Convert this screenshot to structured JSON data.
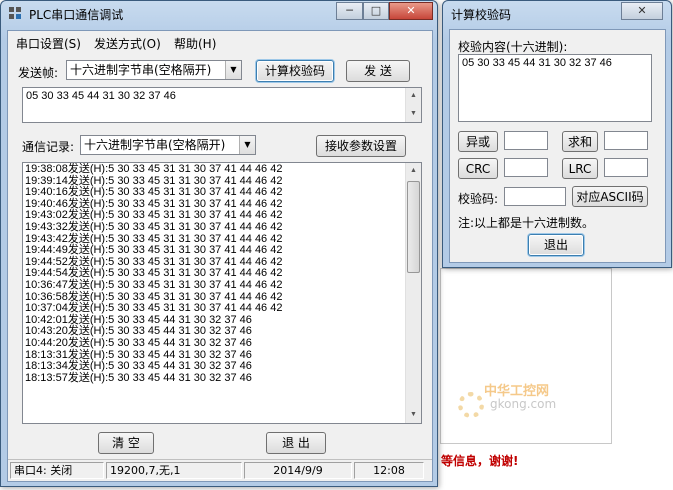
{
  "main_window": {
    "title": "PLC串口通信调试",
    "menu": [
      "串口设置(S)",
      "发送方式(O)",
      "帮助(H)"
    ],
    "send_frame_label": "发送帧:",
    "send_mode_value": "十六进制字节串(空格隔开)",
    "calc_checksum_button": "计算校验码",
    "send_button": "发 送",
    "send_input_value": "05 30 33  45 44 31 30 32 37 46",
    "comm_log_label": "通信记录:",
    "log_mode_value": "十六进制字节串(空格隔开)",
    "recv_settings_button": "接收参数设置",
    "log_lines": [
      "19:38:08发送(H):5 30 33 45 31 31 30 37 41 44 46 42",
      "19:39:14发送(H):5 30 33 45 31 31 30 37 41 44 46 42",
      "19:40:16发送(H):5 30 33 45 31 31 30 37 41 44 46 42",
      "19:40:46发送(H):5 30 33 45 31 31 30 37 41 44 46 42",
      "19:43:02发送(H):5 30 33 45 31 31 30 37 41 44 46 42",
      "19:43:32发送(H):5 30 33 45 31 31 30 37 41 44 46 42",
      "19:43:42发送(H):5 30 33 45 31 31 30 37 41 44 46 42",
      "19:44:49发送(H):5 30 33 45 31 31 30 37 41 44 46 42",
      "19:44:52发送(H):5 30 33 45 31 31 30 37 41 44 46 42",
      "19:44:54发送(H):5 30 33 45 31 31 30 37 41 44 46 42",
      "10:36:47发送(H):5 30 33 45 31 31 30 37 41 44 46 42",
      "10:36:58发送(H):5 30 33 45 31 31 30 37 41 44 46 42",
      "10:37:04发送(H):5 30 33 45 31 31 30 37 41 44 46 42",
      "10:42:01发送(H):5 30 33 45 44 31 30 32 37 46",
      "10:43:20发送(H):5 30 33 45 44 31 30 32 37 46",
      "10:44:20发送(H):5 30 33 45 44 31 30 32 37 46",
      "18:13:31发送(H):5 30 33 45 44 31 30 32 37 46",
      "18:13:34发送(H):5 30 33 45 44 31 30 32 37 46",
      "18:13:57发送(H):5 30 33 45 44 31 30 32 37 46"
    ],
    "clear_button": "清 空",
    "exit_button": "退 出",
    "status": {
      "port": "串口4: 关闭",
      "params": "19200,7,无,1",
      "date": "2014/9/9",
      "time": "12:08"
    }
  },
  "checksum_window": {
    "title": "计算校验码",
    "content_label": "校验内容(十六进制):",
    "content_value": "05 30 33  45 44 31 30 32 37 46",
    "xor_button": "异或",
    "sum_button": "求和",
    "crc_button": "CRC",
    "lrc_button": "LRC",
    "xor_value": "",
    "sum_value": "",
    "crc_value": "",
    "lrc_value": "",
    "checksum_label": "校验码:",
    "checksum_value": "",
    "ascii_button": "对应ASCII码",
    "note": "注:以上都是十六进制数。",
    "exit_button": "退出"
  },
  "background": {
    "footer_text": "等信息，谢谢!",
    "watermark_cn": "中华工控网",
    "watermark_en": "gkong.com"
  },
  "colors": {
    "title_bar": "#b3cbe6",
    "window_face": "#f0f0f0",
    "close_button": "#c7463a",
    "background_text": "#c00000"
  },
  "icons": [
    "app-icon",
    "minimize-icon",
    "maximize-icon",
    "close-icon",
    "chevron-down-icon",
    "scroll-up-icon",
    "scroll-down-icon"
  ]
}
